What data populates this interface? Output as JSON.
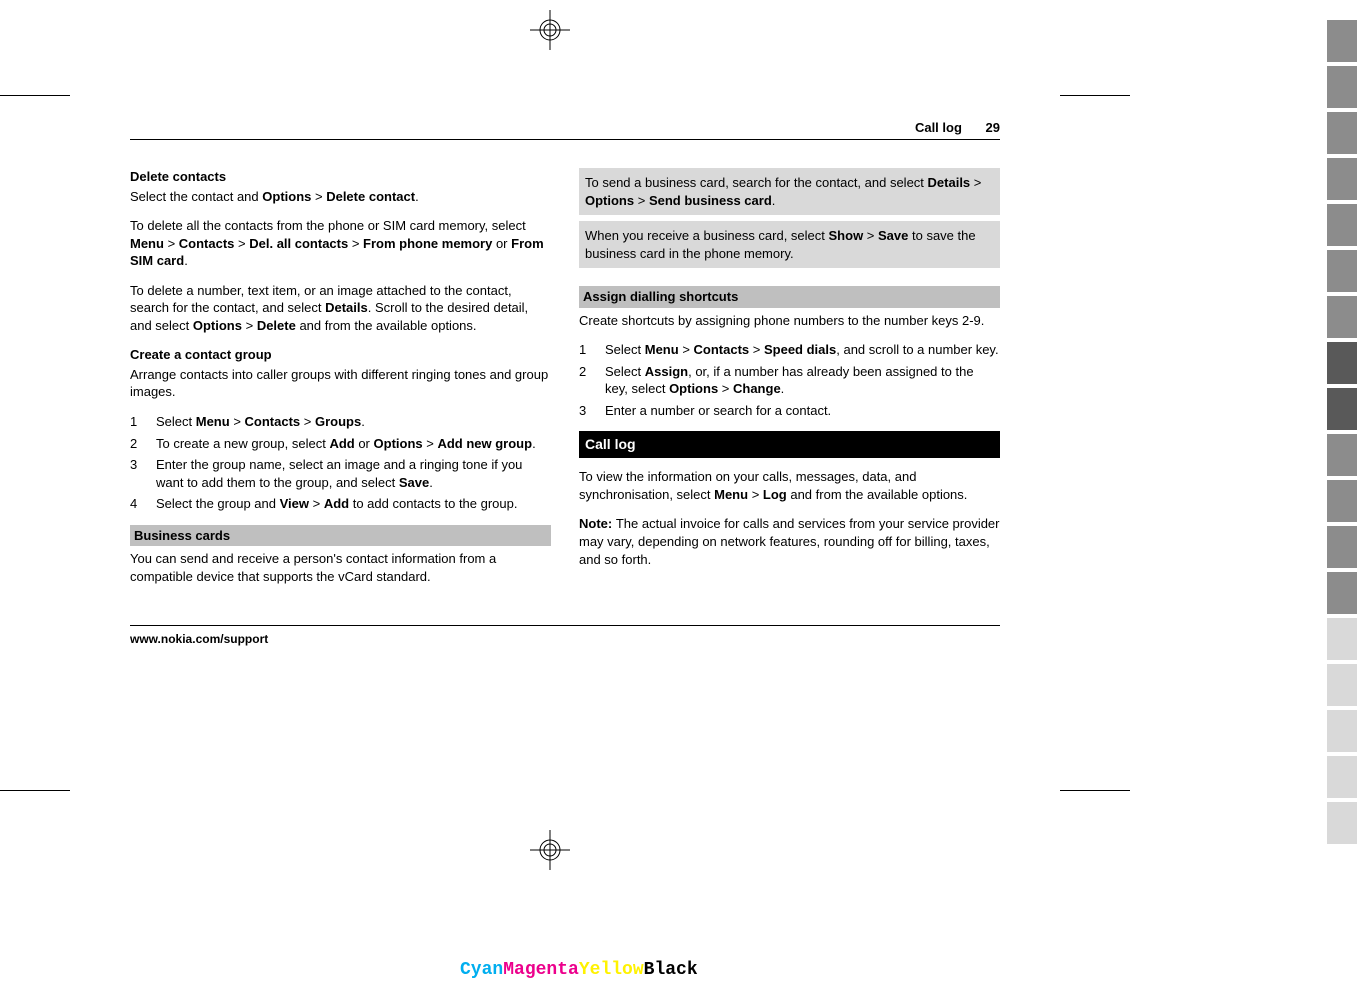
{
  "header": {
    "section": "Call log",
    "page": "29"
  },
  "col1": {
    "h1": "Delete contacts",
    "p1a": "Select the contact and ",
    "p1b": "Options",
    "p1c": " > ",
    "p1d": "Delete contact",
    "p1e": ".",
    "p2a": "To delete all the contacts from the phone or SIM card memory, select ",
    "p2b": "Menu",
    "p2c": " > ",
    "p2d": "Contacts",
    "p2e": " > ",
    "p2f": "Del. all contacts",
    "p2g": " > ",
    "p2h": "From phone memory",
    "p2i": " or ",
    "p2j": "From SIM card",
    "p2k": ".",
    "p3a": "To delete a number, text item, or an image attached to the contact, search for the contact, and select ",
    "p3b": "Details",
    "p3c": ". Scroll to the desired detail, and select ",
    "p3d": "Options",
    "p3e": " > ",
    "p3f": "Delete",
    "p3g": " and from the available options.",
    "h2": "Create a contact group",
    "p4": "Arrange contacts into caller groups with different ringing tones and group images.",
    "s1a": "Select ",
    "s1b": "Menu",
    "s1c": " > ",
    "s1d": "Contacts",
    "s1e": " > ",
    "s1f": "Groups",
    "s1g": ".",
    "s2a": "To create a new group, select ",
    "s2b": "Add",
    "s2c": " or ",
    "s2d": "Options",
    "s2e": " > ",
    "s2f": "Add new group",
    "s2g": ".",
    "s3a": "Enter the group name, select an image and a ringing tone if you want to add them to the group, and select ",
    "s3b": "Save",
    "s3c": ".",
    "s4a": "Select the group and ",
    "s4b": "View",
    "s4c": " > ",
    "s4d": "Add",
    "s4e": " to add contacts to the group.",
    "h3": "Business cards",
    "p5": "You can send and receive a person's contact information from a compatible device that supports the vCard standard."
  },
  "col2": {
    "g1a": "To send a business card, search for the contact, and select ",
    "g1b": "Details",
    "g1c": " > ",
    "g1d": "Options",
    "g1e": " > ",
    "g1f": "Send business card",
    "g1g": ".",
    "g2a": "When you receive a business card, select ",
    "g2b": "Show",
    "g2c": " > ",
    "g2d": "Save",
    "g2e": " to save the business card in the phone memory.",
    "h1": "Assign dialling shortcuts",
    "p1": "Create shortcuts by assigning phone numbers to the number keys 2-9.",
    "s1a": "Select ",
    "s1b": "Menu",
    "s1c": " > ",
    "s1d": "Contacts",
    "s1e": " > ",
    "s1f": "Speed dials",
    "s1g": ", and scroll to a number key.",
    "s2a": "Select ",
    "s2b": "Assign",
    "s2c": ", or, if a number has already been assigned to the key, select ",
    "s2d": "Options",
    "s2e": " > ",
    "s2f": "Change",
    "s2g": ".",
    "s3": "Enter a number or search for a contact.",
    "h2": "Call log",
    "p2a": "To view the information on your calls, messages, data, and synchronisation, select ",
    "p2b": "Menu",
    "p2c": " > ",
    "p2d": "Log",
    "p2e": " and from the available options.",
    "p3a": "Note:  ",
    "p3b": "The actual invoice for calls and services from your service provider may vary, depending on network features, rounding off for billing, taxes, and so forth."
  },
  "footer": {
    "url": "www.nokia.com/support"
  },
  "cmyk": {
    "c": "Cyan",
    "m": "Magenta",
    "y": "Yellow",
    "k": "Black"
  }
}
